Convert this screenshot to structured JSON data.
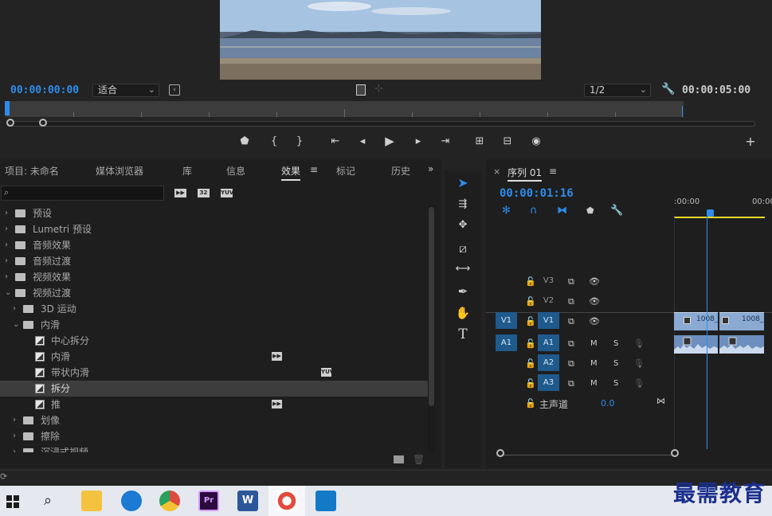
{
  "monitor": {
    "timecode_left": "00:00:00:00",
    "fit_label": "适合",
    "quality_label": "1/2",
    "timecode_right": "00:00:05:00"
  },
  "left_panel": {
    "tabs": [
      "项目: 未命名",
      "媒体浏览器",
      "库",
      "信息",
      "效果",
      "标记",
      "历史"
    ],
    "active_tab": "效果",
    "search_placeholder": "",
    "filter_badges": [
      "32",
      "YUV"
    ],
    "tree": [
      {
        "label": "预设",
        "indent": 0,
        "expanded": false,
        "kind": "preset-folder"
      },
      {
        "label": "Lumetri 预设",
        "indent": 0,
        "expanded": false,
        "kind": "preset-folder"
      },
      {
        "label": "音频效果",
        "indent": 0,
        "expanded": false,
        "kind": "folder"
      },
      {
        "label": "音频过渡",
        "indent": 0,
        "expanded": false,
        "kind": "folder"
      },
      {
        "label": "视频效果",
        "indent": 0,
        "expanded": false,
        "kind": "folder"
      },
      {
        "label": "视频过渡",
        "indent": 0,
        "expanded": true,
        "kind": "folder"
      },
      {
        "label": "3D 运动",
        "indent": 1,
        "expanded": false,
        "kind": "folder"
      },
      {
        "label": "内滑",
        "indent": 1,
        "expanded": true,
        "kind": "folder"
      },
      {
        "label": "中心拆分",
        "indent": 2,
        "kind": "effect"
      },
      {
        "label": "内滑",
        "indent": 2,
        "kind": "effect",
        "badge": "accel"
      },
      {
        "label": "带状内滑",
        "indent": 2,
        "kind": "effect",
        "badge": "yuv"
      },
      {
        "label": "拆分",
        "indent": 2,
        "kind": "effect",
        "selected": true
      },
      {
        "label": "推",
        "indent": 2,
        "kind": "effect",
        "badge": "accel"
      },
      {
        "label": "划像",
        "indent": 1,
        "expanded": false,
        "kind": "folder"
      },
      {
        "label": "擦除",
        "indent": 1,
        "expanded": false,
        "kind": "folder"
      },
      {
        "label": "沉浸式视频",
        "indent": 1,
        "expanded": false,
        "kind": "folder"
      }
    ]
  },
  "timeline": {
    "close": "×",
    "sequence_name": "序列 01",
    "menu": "≡",
    "timecode": "00:00:01:16",
    "ruler_labels": [
      ":00:00",
      "00:00"
    ],
    "video_tracks": [
      {
        "name": "V3",
        "src": ""
      },
      {
        "name": "V2",
        "src": ""
      },
      {
        "name": "V1",
        "src": "V1"
      }
    ],
    "audio_tracks": [
      {
        "name": "A1",
        "src": "A1"
      },
      {
        "name": "A2",
        "src": ""
      },
      {
        "name": "A3",
        "src": ""
      }
    ],
    "master_label": "主声道",
    "master_value": "0.0",
    "mute": "M",
    "solo": "S",
    "clips": [
      "1008_",
      "1008_"
    ]
  },
  "watermark": "最需教育",
  "colors": {
    "accent": "#2d8ceb",
    "panel": "#1e1e1e",
    "track_blue": "#1f5a8c",
    "clip": "#8aa9d3"
  }
}
